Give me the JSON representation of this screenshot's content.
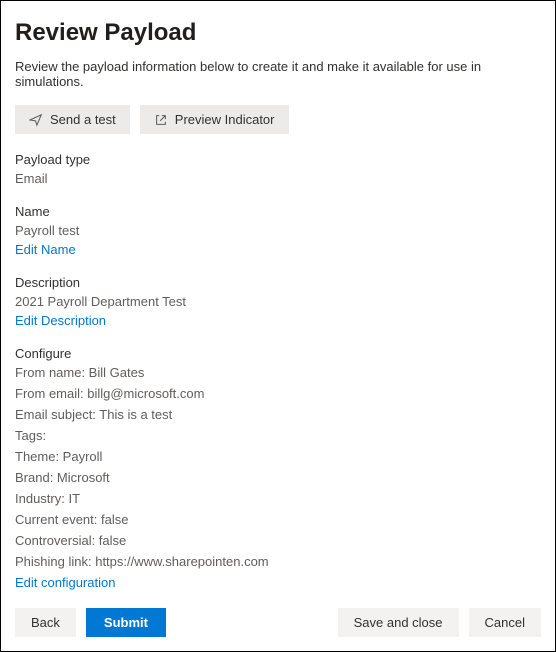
{
  "title": "Review Payload",
  "subtitle": "Review the payload information below to create it and make it available for use in simulations.",
  "actions": {
    "sendTest": "Send a test",
    "previewIndicator": "Preview Indicator"
  },
  "payloadType": {
    "label": "Payload type",
    "value": "Email"
  },
  "name": {
    "label": "Name",
    "value": "Payroll test",
    "editLink": "Edit Name"
  },
  "description": {
    "label": "Description",
    "value": "2021 Payroll Department Test",
    "editLink": "Edit Description"
  },
  "configure": {
    "label": "Configure",
    "rows": {
      "fromName": "From name: Bill Gates",
      "fromEmail": "From email: billg@microsoft.com",
      "subject": "Email subject: This is a test",
      "tags": "Tags:",
      "theme": "Theme: Payroll",
      "brand": "Brand: Microsoft",
      "industry": "Industry: IT",
      "currentEvent": "Current event: false",
      "controversial": "Controversial: false",
      "phishingLink": "Phishing link: https://www.sharepointen.com"
    },
    "editLink": "Edit configuration"
  },
  "footer": {
    "back": "Back",
    "submit": "Submit",
    "saveClose": "Save and close",
    "cancel": "Cancel"
  }
}
